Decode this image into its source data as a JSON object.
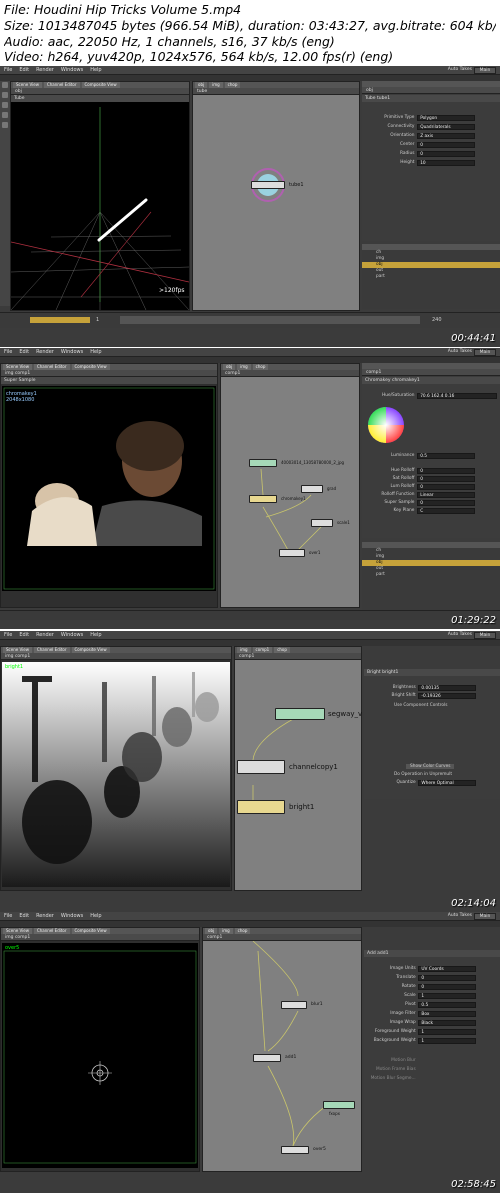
{
  "header": {
    "file": "File: Houdini Hip Tricks Volume 5.mp4",
    "size": "Size: 1013487045 bytes (966.54 MiB), duration: 03:43:27, avg.bitrate: 604 kb/s",
    "audio": "Audio: aac, 22050 Hz, 1 channels, s16, 37 kb/s (eng)",
    "video": "Video: h264, yuv420p, 1024x576, 564 kb/s, 12.00 fps(r) (eng)"
  },
  "menu": [
    "File",
    "Edit",
    "Render",
    "Windows",
    "Help"
  ],
  "autotakes": "Auto Takes",
  "main_label": "Main",
  "frames": [
    {
      "timestamp": "00:44:41",
      "path": "obj",
      "network_path": "tube",
      "node_type": "Tube",
      "node_name": "tube1",
      "net_node_label": "tube1",
      "fps": ">120fps",
      "params": [
        {
          "k": "Primitive Type",
          "v": "Polygon"
        },
        {
          "k": "Connectivity",
          "v": "Quadrilaterals"
        },
        {
          "k": "Orientation",
          "v": "Z axis"
        },
        {
          "k": "Center",
          "v": "0"
        },
        {
          "k": "Radius",
          "v": "0"
        },
        {
          "k": "Height",
          "v": "10"
        }
      ],
      "tree": [
        "ch",
        "img",
        "obj",
        "out",
        "part"
      ],
      "tree_sel": 2,
      "frame_start": "1",
      "frame_end": "240"
    },
    {
      "timestamp": "01:29:22",
      "path": "img",
      "network_path": "comp1",
      "node_type": "Chromakey",
      "node_name": "chromakey1",
      "viewer_label": "chromakey1",
      "res": "2048x1080",
      "nodes": [
        "40003014_13058780000_2_jpg",
        "chromakey1",
        "grad",
        "scale1",
        "over1"
      ],
      "params": [
        {
          "k": "Hue/Saturation",
          "v": "70.6  162.4  0.16"
        },
        {
          "k": "Luminance",
          "v": "0.5"
        },
        {
          "k": "Hue Rolloff",
          "v": "0"
        },
        {
          "k": "Sat Rolloff",
          "v": "0"
        },
        {
          "k": "Lum Rolloff",
          "v": "0"
        },
        {
          "k": "Rolloff Function",
          "v": "Linear"
        },
        {
          "k": "Super Sample",
          "v": "0"
        },
        {
          "k": "Key Plane",
          "v": "C"
        }
      ],
      "tree": [
        "ch",
        "img",
        "obj",
        "out",
        "part"
      ],
      "tree_sel": 2,
      "super_sample": "Super Sample",
      "key_plane": "Key Plane"
    },
    {
      "timestamp": "02:14:04",
      "path": "img",
      "network_path": "comp1",
      "viewer_label": "bright1",
      "node_type": "Bright",
      "node_name": "bright1",
      "nodes": [
        "segway_v",
        "channelcopy1",
        "bright1"
      ],
      "params": [
        {
          "k": "Brightness",
          "v": "0.00135"
        },
        {
          "k": "Bright Shift",
          "v": "-0.19326"
        }
      ],
      "check1": "Use Component Controls",
      "check2": "Do Operation in Unpremult",
      "quantize": "Where Optimal",
      "color_curves": "Show Color Curves"
    },
    {
      "timestamp": "02:58:45",
      "path": "img",
      "network_path": "comp1",
      "viewer_label": "over5",
      "node_type": "Add",
      "node_name": "add1",
      "nodes": [
        "blur1",
        "add1",
        "fxopx",
        "over5"
      ],
      "params": [
        {
          "k": "Image Units",
          "v": "UV Coords"
        },
        {
          "k": "Translate",
          "v": "0"
        },
        {
          "k": "Rotate",
          "v": "0"
        },
        {
          "k": "Scale",
          "v": "1"
        },
        {
          "k": "Pivot",
          "v": "0.5"
        },
        {
          "k": "Image Filter",
          "v": "Box"
        },
        {
          "k": "Image Wrap",
          "v": "Black"
        },
        {
          "k": "Foreground Weight",
          "v": "1"
        },
        {
          "k": "Background Weight",
          "v": "1"
        }
      ],
      "motion": [
        "Motion Blur",
        "Motion Frame Bias",
        "Motion Blur Segme..."
      ]
    }
  ]
}
